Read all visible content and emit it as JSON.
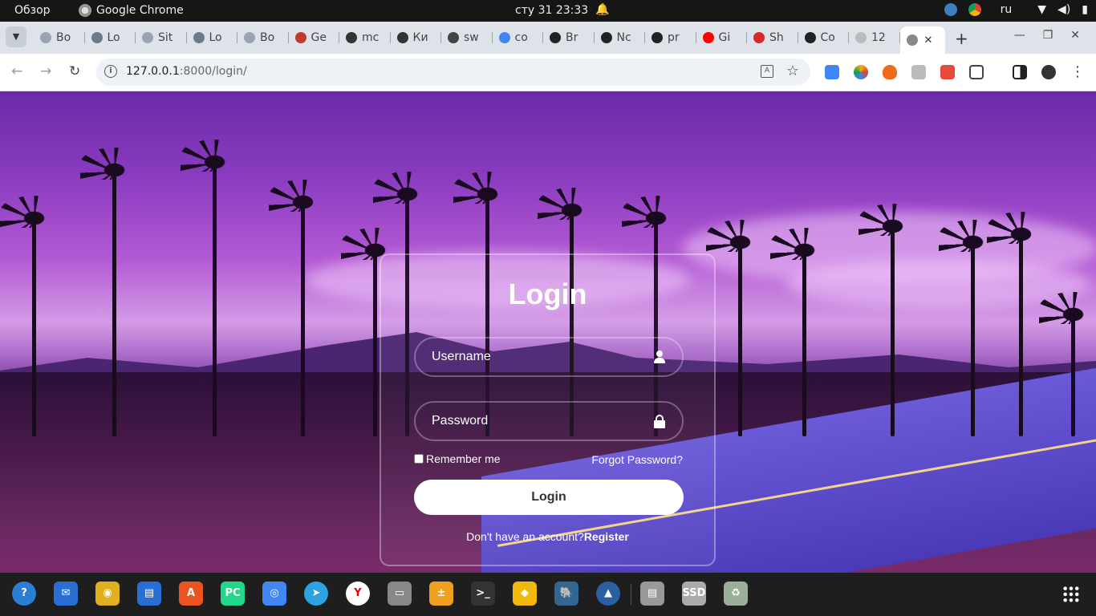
{
  "system_bar": {
    "overview": "Обзор",
    "app_name": "Google Chrome",
    "datetime": "сту 31  23:33",
    "lang": "ru"
  },
  "browser": {
    "tabs": [
      {
        "label": "Bo",
        "icon": "loading-icon",
        "color": "#9aa3b0"
      },
      {
        "label": "Lo",
        "icon": "django-icon",
        "color": "#6c7a8a"
      },
      {
        "label": "Sit",
        "icon": "loading-icon",
        "color": "#9aa3b0"
      },
      {
        "label": "Lo",
        "icon": "django-icon",
        "color": "#6c7a8a"
      },
      {
        "label": "Bo",
        "icon": "loading-icon",
        "color": "#9aa3b0"
      },
      {
        "label": "Ge",
        "icon": "openai-icon",
        "color": "#c0392b"
      },
      {
        "label": "mc",
        "icon": "chatgpt-icon",
        "color": "#333333"
      },
      {
        "label": "Ки",
        "icon": "chatgpt-icon",
        "color": "#333333"
      },
      {
        "label": "sw",
        "icon": "github-icon",
        "color": "#444444"
      },
      {
        "label": "co",
        "icon": "google-icon",
        "color": "#4285f4"
      },
      {
        "label": "Br",
        "icon": "github-icon",
        "color": "#222222"
      },
      {
        "label": "Nc",
        "icon": "github-icon",
        "color": "#222222"
      },
      {
        "label": "pr",
        "icon": "github-icon",
        "color": "#222222"
      },
      {
        "label": "Gi",
        "icon": "youtube-icon",
        "color": "#ff0000"
      },
      {
        "label": "Sh",
        "icon": "opera-icon",
        "color": "#d62828"
      },
      {
        "label": "Co",
        "icon": "github-icon",
        "color": "#222222"
      },
      {
        "label": "12",
        "icon": "loading-icon",
        "color": "#bbbbbb"
      }
    ],
    "active_tab": {
      "icon": "globe-icon",
      "close": "✕"
    },
    "url_host": "127.0.0.1",
    "url_path": ":8000/login/"
  },
  "login": {
    "title": "Login",
    "username_placeholder": "Username",
    "password_placeholder": "Password",
    "remember_label": "Remember me",
    "forgot_label": "Forgot Password?",
    "button_label": "Login",
    "register_prompt": "Don't have an account?",
    "register_link": "Register"
  },
  "colors": {
    "accent": "#ffffff",
    "sky_top": "#6a2aa8",
    "road": "#5b4ac8"
  },
  "dock": [
    {
      "name": "help-icon",
      "color": "#2a7fd4",
      "glyph": "?"
    },
    {
      "name": "thunderbird-icon",
      "color": "#2a6fd4",
      "glyph": "✉"
    },
    {
      "name": "rhythmbox-icon",
      "color": "#e0b020",
      "glyph": "◉"
    },
    {
      "name": "writer-icon",
      "color": "#2a6fd4",
      "glyph": "▤"
    },
    {
      "name": "app-center-icon",
      "color": "#e95420",
      "glyph": "A"
    },
    {
      "name": "pycharm-icon",
      "color": "#21d789",
      "glyph": "PC"
    },
    {
      "name": "chrome-icon",
      "color": "#4285f4",
      "glyph": "◎"
    },
    {
      "name": "telegram-icon",
      "color": "#2aa3e0",
      "glyph": "➤"
    },
    {
      "name": "yandex-icon",
      "color": "#ffffff",
      "glyph": "Y"
    },
    {
      "name": "files-icon",
      "color": "#888888",
      "glyph": "▭"
    },
    {
      "name": "calculator-icon",
      "color": "#f0a020",
      "glyph": "±"
    },
    {
      "name": "terminal-icon",
      "color": "#333333",
      "glyph": ">_"
    },
    {
      "name": "binance-icon",
      "color": "#f0b90b",
      "glyph": "◆"
    },
    {
      "name": "postgres-icon",
      "color": "#336791",
      "glyph": "🐘"
    },
    {
      "name": "mountain-app-icon",
      "color": "#2a5fa0",
      "glyph": "▲"
    },
    {
      "name": "drive-icon",
      "color": "#999999",
      "glyph": "▤"
    },
    {
      "name": "ssd-icon",
      "color": "#aaaaaa",
      "glyph": "SSD"
    },
    {
      "name": "trash-icon",
      "color": "#9ab09a",
      "glyph": "♻"
    }
  ]
}
